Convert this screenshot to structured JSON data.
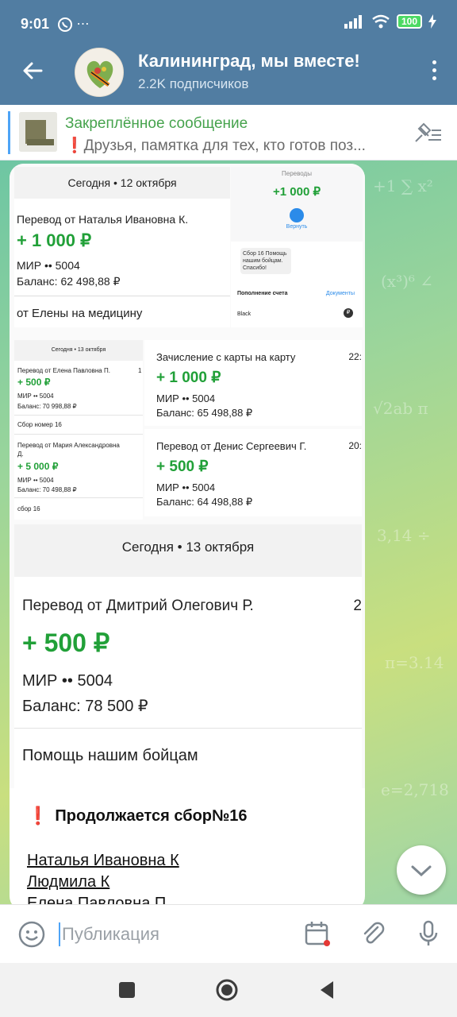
{
  "status_bar": {
    "time": "9:01",
    "extra": "⋯",
    "battery": "100"
  },
  "header": {
    "title": "Калининград, мы вместе!",
    "subtitle": "2.2K подписчиков"
  },
  "pinned": {
    "title": "Закреплённое сообщение",
    "text": "Друзья, памятка для тех, кто готов поз..."
  },
  "message": {
    "screenA": {
      "date": "Сегодня • 12 октября",
      "sender": "Перевод от Наталья Ивановна К.",
      "amount": "+ 1 000 ₽",
      "card": "МИР •• 5004",
      "balance": "Баланс: 62 498,88 ₽",
      "note": "от Елены на медицину"
    },
    "screenB": {
      "header": "Переводы",
      "amount": "+1 000 ₽",
      "refund": "Вернуть",
      "message": "Сбор 16 Помощь нашим бойцам. Спасибо!",
      "account_label": "Пополнение счета",
      "documents": "Документы",
      "card_name": "Black",
      "currency": "₽"
    },
    "screenC": {
      "date": "Сегодня • 13 октября",
      "t1_sender": "Перевод от Елена Павловна П.",
      "t1_time": "1",
      "t1_amount": "+ 500 ₽",
      "t1_card": "МИР •• 5004",
      "t1_balance": "Баланс: 70 998,88 ₽",
      "t1_note": "Сбор номер 16",
      "t2_sender_1": "Перевод от Мария Александровна",
      "t2_sender_2": "Д.",
      "t2_amount": "+ 5 000 ₽",
      "t2_card": "МИР •• 5004",
      "t2_balance": "Баланс: 70 498,88 ₽",
      "t2_note": "сбор 16"
    },
    "screenD": {
      "title": "Зачисление с карты на карту",
      "time": "22:",
      "amount": "+ 1 000 ₽",
      "card": "МИР •• 5004",
      "balance": "Баланс: 65 498,88 ₽"
    },
    "screenE": {
      "title": "Перевод от Денис Сергеевич Г.",
      "time": "20:",
      "amount": "+ 500 ₽",
      "card": "МИР •• 5004",
      "balance": "Баланс: 64 498,88 ₽"
    },
    "screenF": {
      "date": "Сегодня • 13 октября",
      "sender": "Перевод от Дмитрий Олегович Р.",
      "time": "2",
      "amount": "+ 500 ₽",
      "card": "МИР •• 5004",
      "balance": "Баланс: 78 500 ₽",
      "note": "Помощь нашим бойцам"
    },
    "caption": {
      "title": "Продолжается сбор№16",
      "names": [
        "Наталья Ивановна К",
        "Людмила К",
        "Елена Павловна П"
      ]
    }
  },
  "input": {
    "placeholder": "Публикация"
  },
  "colors": {
    "header": "#517da2",
    "accent_green": "#21a038",
    "pinned_title": "#46a34d",
    "link_blue": "#4ea4f6"
  }
}
